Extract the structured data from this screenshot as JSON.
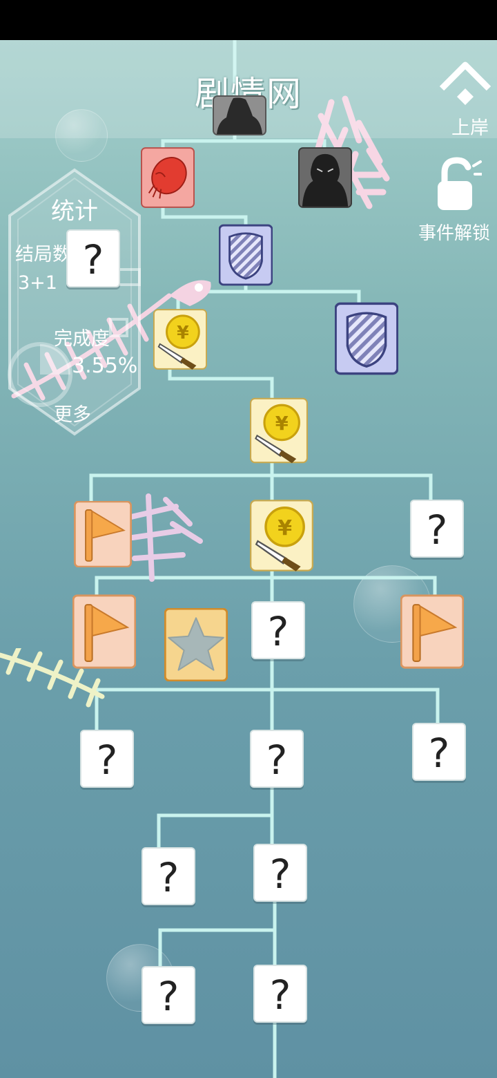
{
  "header": {
    "title": "剧情网"
  },
  "shore": {
    "label": "上岸",
    "icon": "chevron-up-icon"
  },
  "unlock": {
    "label": "事件解锁",
    "icon": "unlock-icon"
  },
  "stats": {
    "heading": "统计",
    "endings_label": "结局数",
    "endings_value": "3+1",
    "completion_label": "完成度",
    "completion_value": "3.55%",
    "more_label": "更多"
  },
  "unknown_mark": "?",
  "colors": {
    "line": "#c9f3ee",
    "coin_card": "#fbf1c4",
    "flag_card": "#f8d3bd",
    "shield_card": "#c7cbf2",
    "red_card": "#f4a7a1",
    "dark_card": "#6a6a6a",
    "star_card": "#f6d58e"
  },
  "nodes": [
    {
      "id": "top-shadow",
      "type": "shadow"
    },
    {
      "id": "red-creature",
      "type": "red"
    },
    {
      "id": "dark-silhouette",
      "type": "dark"
    },
    {
      "id": "shield-1",
      "type": "shield"
    },
    {
      "id": "coin-1",
      "type": "coin"
    },
    {
      "id": "shield-2",
      "type": "shield"
    },
    {
      "id": "coin-2",
      "type": "coin"
    },
    {
      "id": "flag-1",
      "type": "flag"
    },
    {
      "id": "coin-3",
      "type": "coin"
    },
    {
      "id": "unknown-1",
      "type": "unknown"
    },
    {
      "id": "flag-2",
      "type": "flag"
    },
    {
      "id": "star-1",
      "type": "star"
    },
    {
      "id": "unknown-2",
      "type": "unknown"
    },
    {
      "id": "flag-3",
      "type": "flag"
    },
    {
      "id": "unknown-3",
      "type": "unknown"
    },
    {
      "id": "unknown-4",
      "type": "unknown"
    },
    {
      "id": "unknown-5",
      "type": "unknown"
    },
    {
      "id": "unknown-6",
      "type": "unknown"
    },
    {
      "id": "unknown-7",
      "type": "unknown"
    },
    {
      "id": "unknown-8",
      "type": "unknown"
    },
    {
      "id": "unknown-9",
      "type": "unknown"
    },
    {
      "id": "unknown-stats",
      "type": "unknown"
    }
  ]
}
